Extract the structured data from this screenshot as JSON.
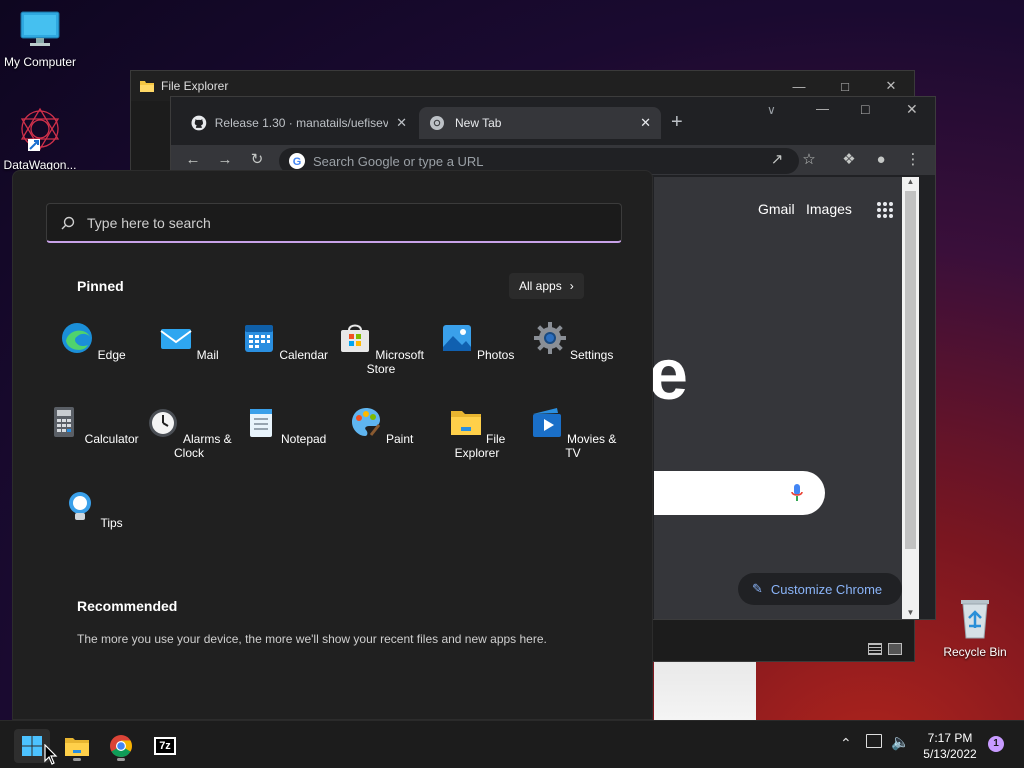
{
  "desktop": {
    "icons": [
      {
        "label": "My Computer",
        "icon": "monitor-icon"
      },
      {
        "label": "DataWagon...",
        "icon": "datawagon-icon"
      },
      {
        "label": "Recycle Bin",
        "icon": "recycle-bin-icon"
      }
    ]
  },
  "file_explorer": {
    "title": "File Explorer"
  },
  "chrome": {
    "tabs": [
      {
        "title": "Release 1.30 · manatails/uefiseve",
        "icon": "github-icon"
      },
      {
        "title": "New Tab",
        "icon": "chrome-icon"
      }
    ],
    "omnibox_placeholder": "Search Google or type a URL",
    "header_links": [
      "Gmail",
      "Images"
    ],
    "customize_label": "Customize Chrome",
    "logo_fragment": "e"
  },
  "start_menu": {
    "search_placeholder": "Type here to search",
    "pinned_title": "Pinned",
    "all_apps_label": "All apps",
    "pinned_apps": [
      {
        "label": "Edge",
        "icon": "edge-icon"
      },
      {
        "label": "Mail",
        "icon": "mail-icon"
      },
      {
        "label": "Calendar",
        "icon": "calendar-icon"
      },
      {
        "label": "Microsoft Store",
        "icon": "store-icon"
      },
      {
        "label": "Photos",
        "icon": "photos-icon"
      },
      {
        "label": "Settings",
        "icon": "settings-icon"
      },
      {
        "label": "Calculator",
        "icon": "calculator-icon"
      },
      {
        "label": "Alarms & Clock",
        "icon": "clock-icon"
      },
      {
        "label": "Notepad",
        "icon": "notepad-icon"
      },
      {
        "label": "Paint",
        "icon": "paint-icon"
      },
      {
        "label": "File Explorer",
        "icon": "folder-icon"
      },
      {
        "label": "Movies & TV",
        "icon": "movies-icon"
      },
      {
        "label": "Tips",
        "icon": "tips-icon"
      }
    ],
    "recommended_title": "Recommended",
    "recommended_text": "The more you use your device, the more we'll show your recent files and new apps here."
  },
  "taskbar": {
    "apps": [
      {
        "name": "Start",
        "icon": "windows-start-icon"
      },
      {
        "name": "File Explorer",
        "icon": "folder-icon"
      },
      {
        "name": "Google Chrome",
        "icon": "chrome-icon"
      },
      {
        "name": "7-Zip",
        "icon": "7zip-icon",
        "text": "7z"
      }
    ],
    "time": "7:17 PM",
    "date": "5/13/2022",
    "notification_count": "1"
  }
}
